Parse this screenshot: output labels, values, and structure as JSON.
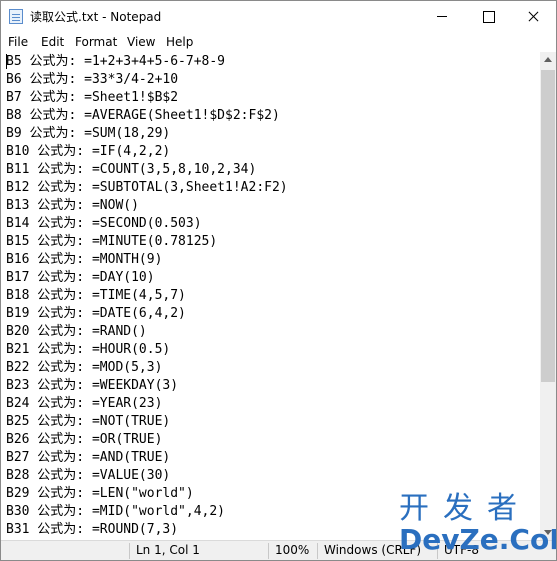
{
  "window": {
    "title": "读取公式.txt - Notepad"
  },
  "menu": {
    "items": [
      "File",
      "Edit",
      "Format",
      "View",
      "Help"
    ]
  },
  "editor": {
    "lines": [
      "B5 公式为: =1+2+3+4+5-6-7+8-9",
      "B6 公式为: =33*3/4-2+10",
      "B7 公式为: =Sheet1!$B$2",
      "B8 公式为: =AVERAGE(Sheet1!$D$2:F$2)",
      "B9 公式为: =SUM(18,29)",
      "B10 公式为: =IF(4,2,2)",
      "B11 公式为: =COUNT(3,5,8,10,2,34)",
      "B12 公式为: =SUBTOTAL(3,Sheet1!A2:F2)",
      "B13 公式为: =NOW()",
      "B14 公式为: =SECOND(0.503)",
      "B15 公式为: =MINUTE(0.78125)",
      "B16 公式为: =MONTH(9)",
      "B17 公式为: =DAY(10)",
      "B18 公式为: =TIME(4,5,7)",
      "B19 公式为: =DATE(6,4,2)",
      "B20 公式为: =RAND()",
      "B21 公式为: =HOUR(0.5)",
      "B22 公式为: =MOD(5,3)",
      "B23 公式为: =WEEKDAY(3)",
      "B24 公式为: =YEAR(23)",
      "B25 公式为: =NOT(TRUE)",
      "B26 公式为: =OR(TRUE)",
      "B27 公式为: =AND(TRUE)",
      "B28 公式为: =VALUE(30)",
      "B29 公式为: =LEN(\"world\")",
      "B30 公式为: =MID(\"world\",4,2)",
      "B31 公式为: =ROUND(7,3)"
    ]
  },
  "status": {
    "position": "Ln 1, Col 1",
    "zoom": "100%",
    "line_ending": "Windows (CRLF)",
    "encoding": "UTF-8"
  },
  "watermark": {
    "top": "开发者",
    "bottom": "DevZe.CoM"
  },
  "colors": {
    "watermark": "#2a6fbf",
    "statusbar": "#f0f0f0",
    "scrollbar_thumb": "#cdcdcd"
  }
}
